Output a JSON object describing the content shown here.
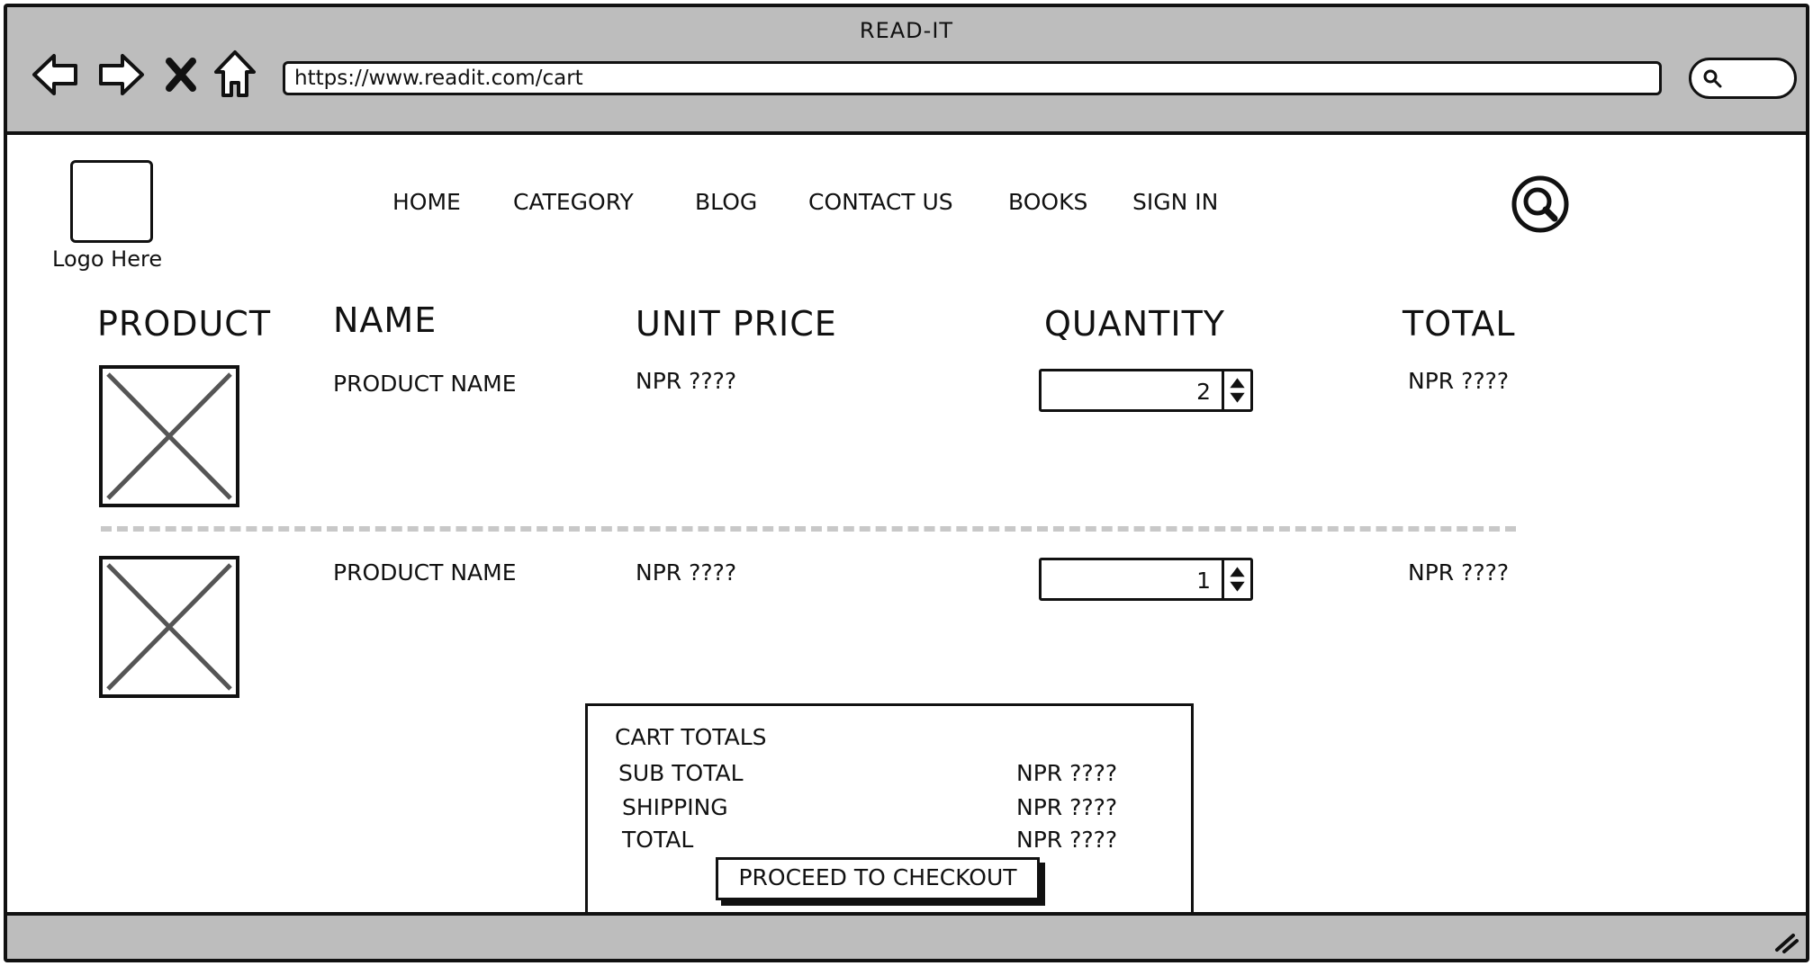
{
  "browser": {
    "title": "READ-IT",
    "url": "https://www.readit.com/cart"
  },
  "header": {
    "logo_text": "Logo Here",
    "menu": [
      "HOME",
      "CATEGORY",
      "BLOG",
      "CONTACT US",
      "BOOKS",
      "SIGN IN"
    ]
  },
  "cart": {
    "columns": [
      "PRODUCT",
      "NAME",
      "UNIT PRICE",
      "QUANTITY",
      "TOTAL"
    ],
    "rows": [
      {
        "name": "PRODUCT NAME",
        "unit_price": "NPR ????",
        "quantity": "2",
        "total": "NPR ????"
      },
      {
        "name": "PRODUCT NAME",
        "unit_price": "NPR ????",
        "quantity": "1",
        "total": "NPR ????"
      }
    ]
  },
  "totals": {
    "title": "CART TOTALS",
    "lines": [
      {
        "label": "SUB TOTAL",
        "value": "NPR ????"
      },
      {
        "label": "SHIPPING",
        "value": "NPR ????"
      },
      {
        "label": "TOTAL",
        "value": "NPR ????"
      }
    ],
    "checkout_label": "PROCEED TO CHECKOUT"
  },
  "icons": {
    "back": "arrow-left-icon",
    "forward": "arrow-right-icon",
    "stop": "close-icon",
    "home": "home-icon",
    "browser_search": "search-icon",
    "site_search": "search-icon",
    "image_placeholder": "image-placeholder-icon",
    "stepper": "stepper-arrows-icon",
    "resize": "resize-grip-icon"
  }
}
